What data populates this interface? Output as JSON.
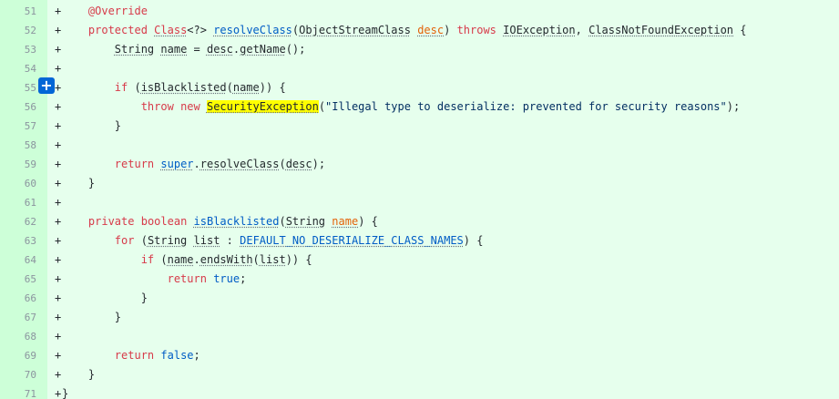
{
  "add_comment_symbol": "+",
  "lines": [
    {
      "n": "51",
      "m": "+",
      "t": [
        {
          "s": "    "
        },
        {
          "s": "@Override",
          "c": "ann"
        }
      ]
    },
    {
      "n": "52",
      "m": "+",
      "t": [
        {
          "s": "    "
        },
        {
          "s": "protected",
          "c": "kw"
        },
        {
          "s": " "
        },
        {
          "s": "Class",
          "c": "kw u"
        },
        {
          "s": "<?> "
        },
        {
          "s": "resolveClass",
          "c": "fn u"
        },
        {
          "s": "("
        },
        {
          "s": "ObjectStreamClass",
          "c": "u"
        },
        {
          "s": " "
        },
        {
          "s": "desc",
          "c": "param u"
        },
        {
          "s": ") "
        },
        {
          "s": "throws",
          "c": "kw"
        },
        {
          "s": " "
        },
        {
          "s": "IOException",
          "c": "u"
        },
        {
          "s": ", "
        },
        {
          "s": "ClassNotFoundException",
          "c": "u"
        },
        {
          "s": " {"
        }
      ]
    },
    {
      "n": "53",
      "m": "+",
      "t": [
        {
          "s": "        "
        },
        {
          "s": "String",
          "c": "u"
        },
        {
          "s": " "
        },
        {
          "s": "name",
          "c": "u"
        },
        {
          "s": " = "
        },
        {
          "s": "desc",
          "c": "u"
        },
        {
          "s": "."
        },
        {
          "s": "getName",
          "c": "u"
        },
        {
          "s": "();"
        }
      ]
    },
    {
      "n": "54",
      "m": "+",
      "t": []
    },
    {
      "n": "55",
      "m": "+",
      "t": [
        {
          "s": "        "
        },
        {
          "s": "if",
          "c": "kw"
        },
        {
          "s": " ("
        },
        {
          "s": "isBlacklisted",
          "c": "u"
        },
        {
          "s": "("
        },
        {
          "s": "name",
          "c": "u"
        },
        {
          "s": ")) {"
        }
      ]
    },
    {
      "n": "56",
      "m": "+",
      "t": [
        {
          "s": "            "
        },
        {
          "s": "throw",
          "c": "kw"
        },
        {
          "s": " "
        },
        {
          "s": "new",
          "c": "kw"
        },
        {
          "s": " "
        },
        {
          "s": "SecurityException",
          "c": "hl u"
        },
        {
          "s": "("
        },
        {
          "s": "\"Illegal type to deserialize: prevented for security reasons\"",
          "c": "str"
        },
        {
          "s": ");"
        }
      ]
    },
    {
      "n": "57",
      "m": "+",
      "t": [
        {
          "s": "        }"
        }
      ]
    },
    {
      "n": "58",
      "m": "+",
      "t": []
    },
    {
      "n": "59",
      "m": "+",
      "t": [
        {
          "s": "        "
        },
        {
          "s": "return",
          "c": "kw"
        },
        {
          "s": " "
        },
        {
          "s": "super",
          "c": "fn u"
        },
        {
          "s": "."
        },
        {
          "s": "resolveClass",
          "c": "u"
        },
        {
          "s": "("
        },
        {
          "s": "desc",
          "c": "u"
        },
        {
          "s": ");"
        }
      ]
    },
    {
      "n": "60",
      "m": "+",
      "t": [
        {
          "s": "    }"
        }
      ]
    },
    {
      "n": "61",
      "m": "+",
      "t": []
    },
    {
      "n": "62",
      "m": "+",
      "t": [
        {
          "s": "    "
        },
        {
          "s": "private",
          "c": "kw"
        },
        {
          "s": " "
        },
        {
          "s": "boolean",
          "c": "kw"
        },
        {
          "s": " "
        },
        {
          "s": "isBlacklisted",
          "c": "fn u"
        },
        {
          "s": "("
        },
        {
          "s": "String",
          "c": "u"
        },
        {
          "s": " "
        },
        {
          "s": "name",
          "c": "param u"
        },
        {
          "s": ") {"
        }
      ]
    },
    {
      "n": "63",
      "m": "+",
      "t": [
        {
          "s": "        "
        },
        {
          "s": "for",
          "c": "kw"
        },
        {
          "s": " ("
        },
        {
          "s": "String",
          "c": "u"
        },
        {
          "s": " "
        },
        {
          "s": "list",
          "c": "u"
        },
        {
          "s": " : "
        },
        {
          "s": "DEFAULT_NO_DESERIALIZE_CLASS_NAMES",
          "c": "const u"
        },
        {
          "s": ") {"
        }
      ]
    },
    {
      "n": "64",
      "m": "+",
      "t": [
        {
          "s": "            "
        },
        {
          "s": "if",
          "c": "kw"
        },
        {
          "s": " ("
        },
        {
          "s": "name",
          "c": "u"
        },
        {
          "s": "."
        },
        {
          "s": "endsWith",
          "c": "u"
        },
        {
          "s": "("
        },
        {
          "s": "list",
          "c": "u"
        },
        {
          "s": ")) {"
        }
      ]
    },
    {
      "n": "65",
      "m": "+",
      "t": [
        {
          "s": "                "
        },
        {
          "s": "return",
          "c": "kw"
        },
        {
          "s": " "
        },
        {
          "s": "true",
          "c": "fn"
        },
        {
          "s": ";"
        }
      ]
    },
    {
      "n": "66",
      "m": "+",
      "t": [
        {
          "s": "            }"
        }
      ]
    },
    {
      "n": "67",
      "m": "+",
      "t": [
        {
          "s": "        }"
        }
      ]
    },
    {
      "n": "68",
      "m": "+",
      "t": []
    },
    {
      "n": "69",
      "m": "+",
      "t": [
        {
          "s": "        "
        },
        {
          "s": "return",
          "c": "kw"
        },
        {
          "s": " "
        },
        {
          "s": "false",
          "c": "fn"
        },
        {
          "s": ";"
        }
      ]
    },
    {
      "n": "70",
      "m": "+",
      "t": [
        {
          "s": "    }"
        }
      ]
    },
    {
      "n": "71",
      "m": "+",
      "t": [
        {
          "s": "}"
        }
      ]
    }
  ]
}
